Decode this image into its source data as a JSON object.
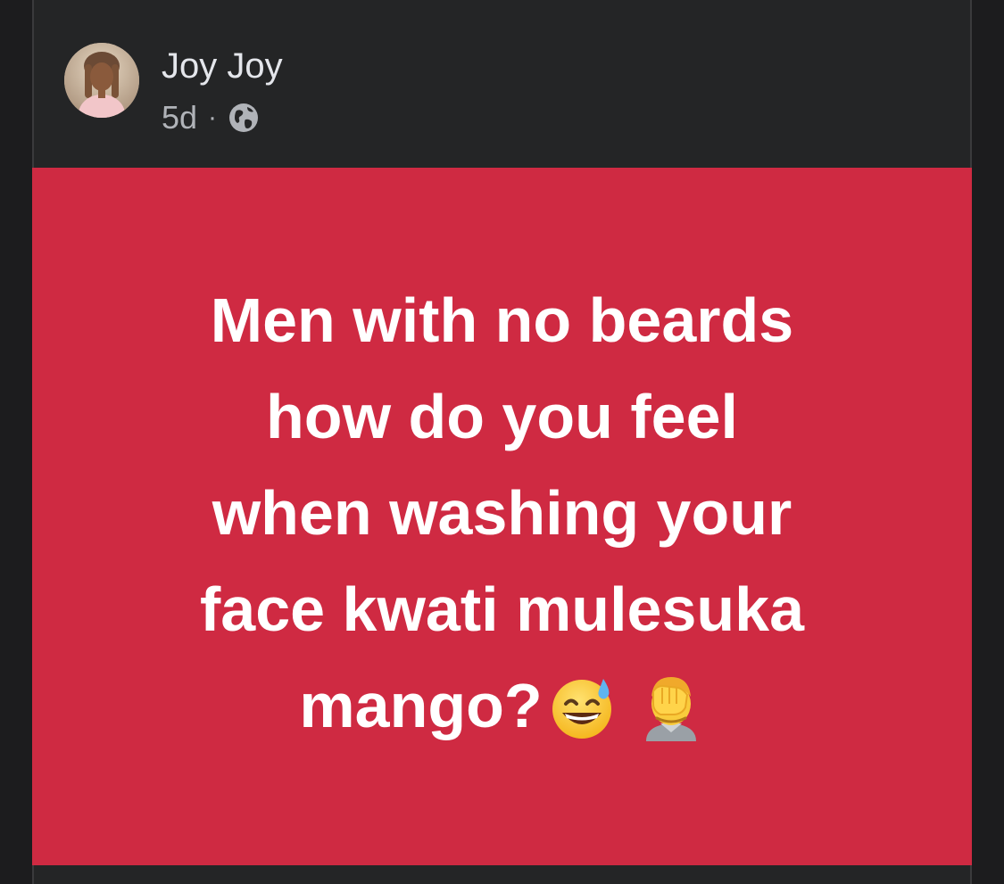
{
  "post": {
    "author_name": "Joy Joy",
    "time_ago": "5d",
    "separator": "·",
    "audience_icon": "globe-icon",
    "text_lines": [
      "Men with no beards",
      "how do you feel",
      "when washing your",
      "face kwati mulesuka",
      "mango?"
    ],
    "emojis": [
      "grinning-face-with-sweat-emoji",
      "face-palm-emoji"
    ],
    "background_color": "#cf2a42",
    "text_color": "#ffffff"
  },
  "theme": {
    "card_bg": "#242526",
    "author_color": "#e4e6eb",
    "meta_color": "#b0b3b8"
  }
}
